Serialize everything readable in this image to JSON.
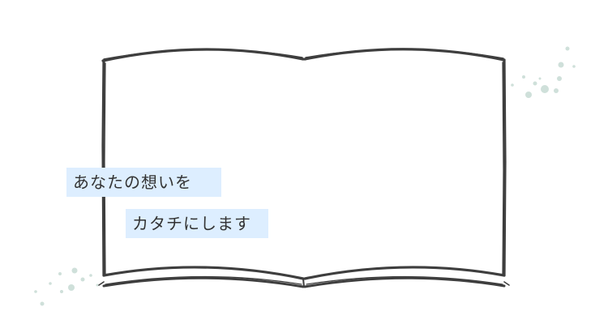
{
  "caption": {
    "line1": "あなたの想いを",
    "line2": "カタチにします"
  },
  "colors": {
    "book_stroke": "#3e3e3e",
    "caption_background": "#ddeeff",
    "caption_text": "#333333",
    "dots": "#cfe0da",
    "background": "#ffffff"
  },
  "icons": {
    "book": "open-book-illustration",
    "dots": "sparkle-dots"
  }
}
